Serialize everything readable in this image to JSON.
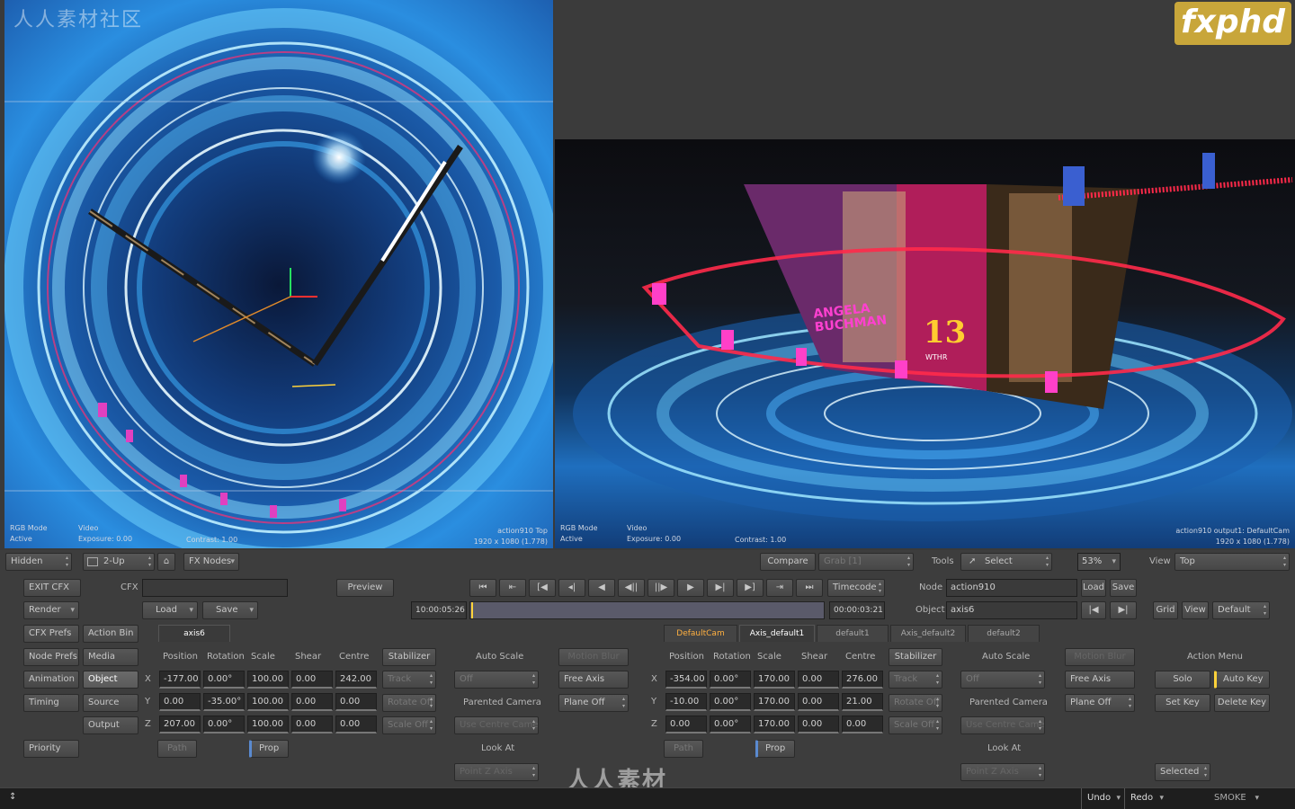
{
  "watermarks": {
    "left_top": "人人素材社区",
    "logo": "fxphd",
    "bottom": "人人素材"
  },
  "viewport_left": {
    "info_left_1": "RGB Mode",
    "info_left_2": "Active",
    "info_mid_1": "Video",
    "info_mid_2": "Exposure: 0.00",
    "info_contrast": "Contrast: 1.00",
    "info_right_1": "action910 Top",
    "info_right_2": "1920 x 1080 (1.778)"
  },
  "viewport_right": {
    "info_left_1": "RGB Mode",
    "info_left_2": "Active",
    "info_mid_1": "Video",
    "info_mid_2": "Exposure: 0.00",
    "info_contrast": "Contrast: 1.00",
    "info_right_1": "action910 output1: DefaultCam",
    "info_right_2": "1920 x 1080 (1.778)",
    "lower_third": "ANGELA BUCHMAN",
    "channel": "13",
    "channel_sub": "WTHR"
  },
  "toolbar": {
    "hidden": "Hidden",
    "layout": "2-Up",
    "fx_nodes": "FX Nodes",
    "compare": "Compare",
    "grab": "Grab [1]",
    "tools_label": "Tools",
    "select": "Select",
    "zoom": "53%",
    "view_label": "View",
    "view_value": "Top"
  },
  "row2": {
    "exit": "EXIT CFX",
    "cfx_label": "CFX",
    "preview": "Preview",
    "timecode_mode": "Timecode",
    "node_label": "Node",
    "node_value": "action910",
    "load": "Load",
    "save": "Save"
  },
  "row3": {
    "render": "Render",
    "load": "Load",
    "save": "Save",
    "tc_start": "10:00:05:26",
    "tc_end": "00:00:03:21",
    "object_label": "Object",
    "object_value": "axis6",
    "grid": "Grid",
    "view": "View",
    "default": "Default"
  },
  "left_menu": {
    "cfx_prefs": "CFX Prefs",
    "action_bin": "Action Bin",
    "node_prefs": "Node Prefs",
    "media": "Media",
    "animation": "Animation",
    "object": "Object",
    "timing": "Timing",
    "source": "Source",
    "output": "Output",
    "priority": "Priority"
  },
  "axis_left": {
    "tab": "axis6",
    "headers": [
      "Position",
      "Rotation",
      "Scale",
      "Shear",
      "Centre"
    ],
    "rows": [
      {
        "axis": "X",
        "values": [
          "-177.00",
          "0.00°",
          "100.00",
          "0.00",
          "242.00"
        ]
      },
      {
        "axis": "Y",
        "values": [
          "0.00",
          "-35.00°",
          "100.00",
          "0.00",
          "0.00"
        ]
      },
      {
        "axis": "Z",
        "values": [
          "207.00",
          "0.00°",
          "100.00",
          "0.00",
          "0.00"
        ]
      }
    ],
    "stabilizer": "Stabilizer",
    "track": "Track",
    "rotate_off": "Rotate Off",
    "scale_off": "Scale Off",
    "path": "Path",
    "prop": "Prop",
    "auto_scale": "Auto Scale",
    "auto_scale_val": "Off",
    "parented_camera": "Parented Camera",
    "use_centre": "Use Centre Camer",
    "look_at": "Look At",
    "point_z": "Point Z Axis",
    "motion_blur": "Motion Blur",
    "free_axis": "Free Axis",
    "plane_off": "Plane Off"
  },
  "axis_right": {
    "tabs": [
      "DefaultCam",
      "Axis_default1",
      "default1",
      "Axis_default2",
      "default2"
    ],
    "headers": [
      "Position",
      "Rotation",
      "Scale",
      "Shear",
      "Centre"
    ],
    "rows": [
      {
        "axis": "X",
        "values": [
          "-354.00",
          "0.00°",
          "170.00",
          "0.00",
          "276.00"
        ]
      },
      {
        "axis": "Y",
        "values": [
          "-10.00",
          "0.00°",
          "170.00",
          "0.00",
          "21.00"
        ]
      },
      {
        "axis": "Z",
        "values": [
          "0.00",
          "0.00°",
          "170.00",
          "0.00",
          "0.00"
        ]
      }
    ],
    "stabilizer": "Stabilizer",
    "track": "Track",
    "rotate_off": "Rotate Off",
    "scale_off": "Scale Off",
    "path": "Path",
    "prop": "Prop",
    "auto_scale": "Auto Scale",
    "auto_scale_val": "Off",
    "parented_camera": "Parented Camera",
    "use_centre": "Use Centre Camer",
    "look_at": "Look At",
    "point_z": "Point Z Axis",
    "motion_blur": "Motion Blur",
    "free_axis": "Free Axis",
    "plane_off": "Plane Off"
  },
  "action_menu": {
    "title": "Action Menu",
    "solo": "Solo",
    "auto_key": "Auto Key",
    "set_key": "Set Key",
    "delete_key": "Delete Key",
    "selected": "Selected"
  },
  "status": {
    "undo": "Undo",
    "redo": "Redo",
    "app": "SMOKE"
  }
}
